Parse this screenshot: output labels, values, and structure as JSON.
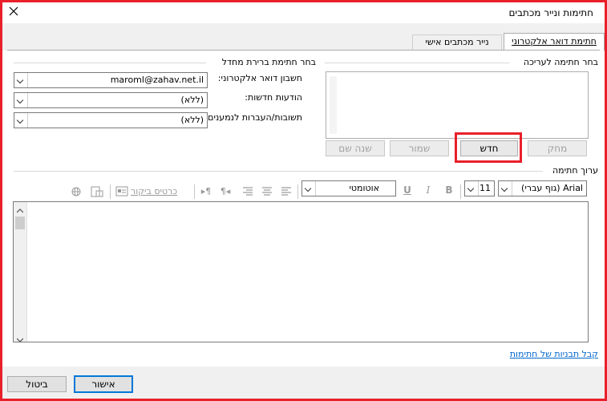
{
  "window": {
    "title": "חתימות ונייר מכתבים",
    "close_icon": "close-icon"
  },
  "tabs": [
    {
      "label": "חתימת דואר אלקטרוני",
      "active": true
    },
    {
      "label": "נייר מכתבים אישי",
      "active": false
    }
  ],
  "select_signature": {
    "label": "בחר חתימה לעריכה"
  },
  "defaults": {
    "label": "בחר חתימת ברירת מחדל",
    "account": {
      "label": "חשבון דואר אלקטרוני:",
      "value": "maroml@zahav.net.il"
    },
    "new_messages": {
      "label": "הודעות חדשות:",
      "value": "(ללא)"
    },
    "replies": {
      "label": "תשובות/העברות לנמענים:",
      "value": "(ללא)"
    }
  },
  "buttons": {
    "delete": "מחק",
    "new": "חדש",
    "save": "שמור",
    "rename": "שנה שם",
    "ok": "אישור",
    "cancel": "ביטול"
  },
  "edit": {
    "label": "ערוך חתימה",
    "font": "(גוף עברי) Arial",
    "size": "11",
    "bold": "B",
    "italic": "I",
    "underline": "U",
    "color": "אוטומטי",
    "business_card": "כרטיס ביקור"
  },
  "templates_link": "קבל תבניות של חתימות",
  "colors": {
    "highlight": "#e8202a",
    "link": "#0066cc",
    "accent": "#0078d7"
  }
}
